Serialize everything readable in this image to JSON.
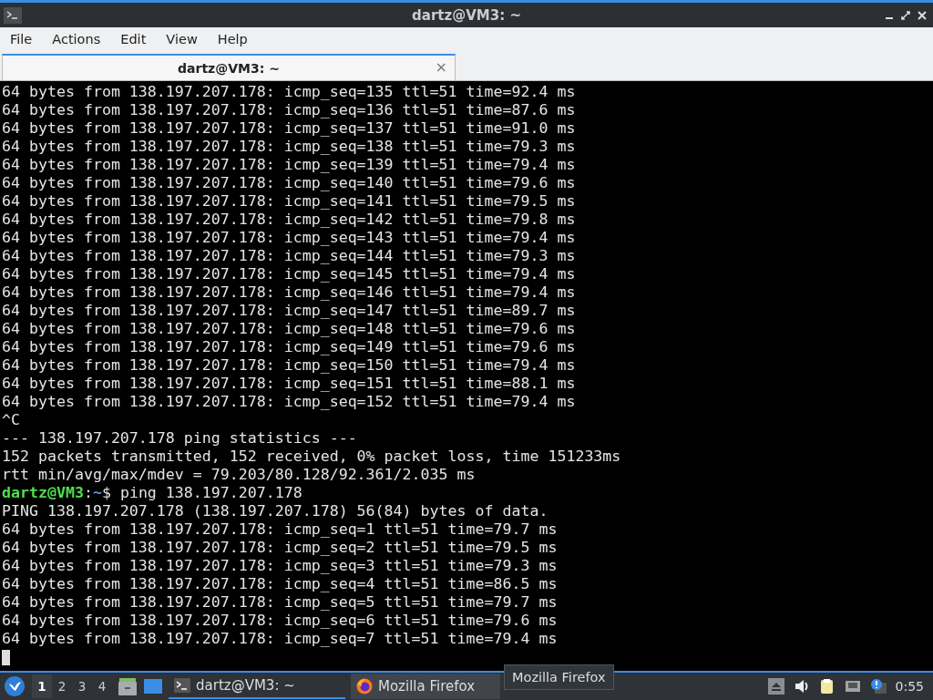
{
  "window": {
    "title": "dartz@VM3: ~"
  },
  "menu": [
    "File",
    "Actions",
    "Edit",
    "View",
    "Help"
  ],
  "tabs": [
    {
      "label": "dartz@VM3: ~",
      "selected": true,
      "close": "×"
    }
  ],
  "terminal": {
    "lines": [
      {
        "kind": "output",
        "text": "64 bytes from 138.197.207.178: icmp_seq=135 ttl=51 time=92.4 ms"
      },
      {
        "kind": "output",
        "text": "64 bytes from 138.197.207.178: icmp_seq=136 ttl=51 time=87.6 ms"
      },
      {
        "kind": "output",
        "text": "64 bytes from 138.197.207.178: icmp_seq=137 ttl=51 time=91.0 ms"
      },
      {
        "kind": "output",
        "text": "64 bytes from 138.197.207.178: icmp_seq=138 ttl=51 time=79.3 ms"
      },
      {
        "kind": "output",
        "text": "64 bytes from 138.197.207.178: icmp_seq=139 ttl=51 time=79.4 ms"
      },
      {
        "kind": "output",
        "text": "64 bytes from 138.197.207.178: icmp_seq=140 ttl=51 time=79.6 ms"
      },
      {
        "kind": "output",
        "text": "64 bytes from 138.197.207.178: icmp_seq=141 ttl=51 time=79.5 ms"
      },
      {
        "kind": "output",
        "text": "64 bytes from 138.197.207.178: icmp_seq=142 ttl=51 time=79.8 ms"
      },
      {
        "kind": "output",
        "text": "64 bytes from 138.197.207.178: icmp_seq=143 ttl=51 time=79.4 ms"
      },
      {
        "kind": "output",
        "text": "64 bytes from 138.197.207.178: icmp_seq=144 ttl=51 time=79.3 ms"
      },
      {
        "kind": "output",
        "text": "64 bytes from 138.197.207.178: icmp_seq=145 ttl=51 time=79.4 ms"
      },
      {
        "kind": "output",
        "text": "64 bytes from 138.197.207.178: icmp_seq=146 ttl=51 time=79.4 ms"
      },
      {
        "kind": "output",
        "text": "64 bytes from 138.197.207.178: icmp_seq=147 ttl=51 time=89.7 ms"
      },
      {
        "kind": "output",
        "text": "64 bytes from 138.197.207.178: icmp_seq=148 ttl=51 time=79.6 ms"
      },
      {
        "kind": "output",
        "text": "64 bytes from 138.197.207.178: icmp_seq=149 ttl=51 time=79.6 ms"
      },
      {
        "kind": "output",
        "text": "64 bytes from 138.197.207.178: icmp_seq=150 ttl=51 time=79.4 ms"
      },
      {
        "kind": "output",
        "text": "64 bytes from 138.197.207.178: icmp_seq=151 ttl=51 time=88.1 ms"
      },
      {
        "kind": "output",
        "text": "64 bytes from 138.197.207.178: icmp_seq=152 ttl=51 time=79.4 ms"
      },
      {
        "kind": "output",
        "text": "^C"
      },
      {
        "kind": "output",
        "text": "--- 138.197.207.178 ping statistics ---"
      },
      {
        "kind": "output",
        "text": "152 packets transmitted, 152 received, 0% packet loss, time 151233ms"
      },
      {
        "kind": "output",
        "text": "rtt min/avg/max/mdev = 79.203/80.128/92.361/2.035 ms"
      },
      {
        "kind": "prompt",
        "user_host": "dartz@VM3",
        "separator": ":",
        "path": "~",
        "command": "$ ping 138.197.207.178"
      },
      {
        "kind": "output",
        "text": "PING 138.197.207.178 (138.197.207.178) 56(84) bytes of data."
      },
      {
        "kind": "output",
        "text": "64 bytes from 138.197.207.178: icmp_seq=1 ttl=51 time=79.7 ms"
      },
      {
        "kind": "output",
        "text": "64 bytes from 138.197.207.178: icmp_seq=2 ttl=51 time=79.5 ms"
      },
      {
        "kind": "output",
        "text": "64 bytes from 138.197.207.178: icmp_seq=3 ttl=51 time=79.3 ms"
      },
      {
        "kind": "output",
        "text": "64 bytes from 138.197.207.178: icmp_seq=4 ttl=51 time=86.5 ms"
      },
      {
        "kind": "output",
        "text": "64 bytes from 138.197.207.178: icmp_seq=5 ttl=51 time=79.7 ms"
      },
      {
        "kind": "output",
        "text": "64 bytes from 138.197.207.178: icmp_seq=6 ttl=51 time=79.6 ms"
      },
      {
        "kind": "output",
        "text": "64 bytes from 138.197.207.178: icmp_seq=7 ttl=51 time=79.4 ms"
      }
    ],
    "cursor_visible": true
  },
  "taskbar": {
    "desktops": [
      {
        "label": "1",
        "selected": true
      },
      {
        "label": "2",
        "selected": false
      },
      {
        "label": "3",
        "selected": false
      },
      {
        "label": "4",
        "selected": false
      }
    ],
    "tasks": [
      {
        "kind": "terminal",
        "label": "dartz@VM3: ~",
        "selected": true
      },
      {
        "kind": "firefox",
        "label": "Mozilla Firefox",
        "selected": false
      }
    ],
    "tooltip": "Mozilla Firefox",
    "clock": "0:55"
  }
}
